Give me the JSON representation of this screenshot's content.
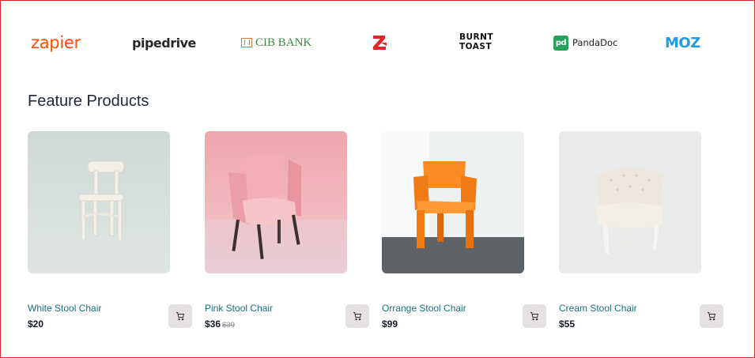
{
  "brands": {
    "zapier": "zapier",
    "pipedrive": "pipedrive",
    "cib": "CIB BANK",
    "zoho": "zoho-logo-icon",
    "burnt_line1": "BURNT",
    "burnt_line2": "TOAST",
    "pandadoc": "PandaDoc",
    "pandadoc_mark": "pd",
    "moz": "MOZ"
  },
  "section": {
    "title": "Feature Products"
  },
  "products": [
    {
      "name": "White Stool Chair",
      "price": "$20",
      "old_price": "",
      "cart_icon": "cart-icon"
    },
    {
      "name": "Pink Stool Chair",
      "price": "$36",
      "old_price": "$39",
      "cart_icon": "cart-icon"
    },
    {
      "name": "Orrange Stool Chair",
      "price": "$99",
      "old_price": "",
      "cart_icon": "cart-icon"
    },
    {
      "name": "Cream Stool Chair",
      "price": "$55",
      "old_price": "",
      "cart_icon": "cart-icon"
    }
  ],
  "colors": {
    "border": "#d9282f",
    "product_name": "#1d6f7a",
    "cart_bg": "#e5e2e1",
    "zapier": "#ff4f00",
    "moz": "#1f9ce6",
    "pandadoc": "#24a35a"
  }
}
